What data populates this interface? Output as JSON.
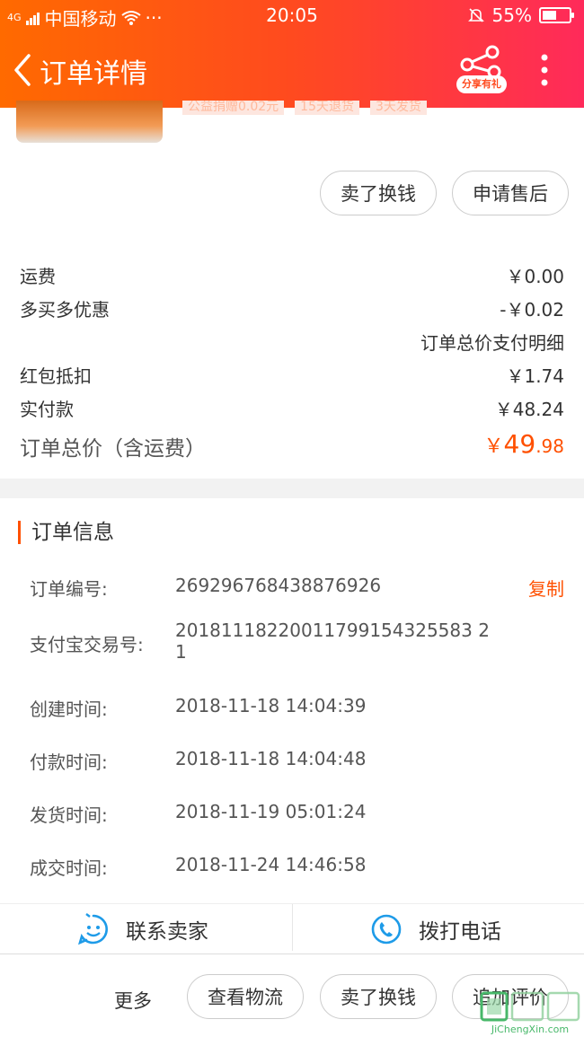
{
  "status_bar": {
    "carrier": "中国移动",
    "network": "4G",
    "dots": "···",
    "time": "20:05",
    "battery": "55%",
    "battery_level": 0.55
  },
  "header": {
    "title": "订单详情",
    "share_label": "分享有礼",
    "accent_gradient": [
      "#ff6a00",
      "#ff2a5a"
    ]
  },
  "product": {
    "tags": [
      "公益捐赠0.02元",
      "15天退货",
      "3天发货"
    ]
  },
  "product_actions": {
    "sell_label": "卖了换钱",
    "after_sale_label": "申请售后"
  },
  "price_breakdown": {
    "shipping_label": "运费",
    "shipping_value": "￥0.00",
    "discount_label": "多买多优惠",
    "discount_value": "-￥0.02",
    "detail_link": "订单总价支付明细",
    "redpacket_label": "红包抵扣",
    "redpacket_value": "￥1.74",
    "paid_label": "实付款",
    "paid_value": "￥48.24",
    "total_label": "订单总价（含运费）",
    "total_symbol": "￥",
    "total_int": "49",
    "total_dec": ".98"
  },
  "order_info": {
    "section_title": "订单信息",
    "copy_label": "复制",
    "rows": [
      {
        "key": "订单编号:",
        "value": "269296768438876926"
      },
      {
        "key": "支付宝交易号:",
        "value": "20181118220011799154325583 2 1"
      },
      {
        "key": "创建时间:",
        "value": "2018-11-18 14:04:39"
      },
      {
        "key": "付款时间:",
        "value": "2018-11-18 14:04:48"
      },
      {
        "key": "发货时间:",
        "value": "2018-11-19 05:01:24"
      },
      {
        "key": "成交时间:",
        "value": "2018-11-24 14:46:58"
      }
    ]
  },
  "contact": {
    "seller_label": "联系卖家",
    "phone_label": "拨打电话"
  },
  "bottom_bar": {
    "more_label": "更多",
    "logistics_label": "查看物流",
    "sell_label": "卖了换钱",
    "review_label": "追加评价"
  },
  "watermark": {
    "text": "JiChengXin.com"
  }
}
